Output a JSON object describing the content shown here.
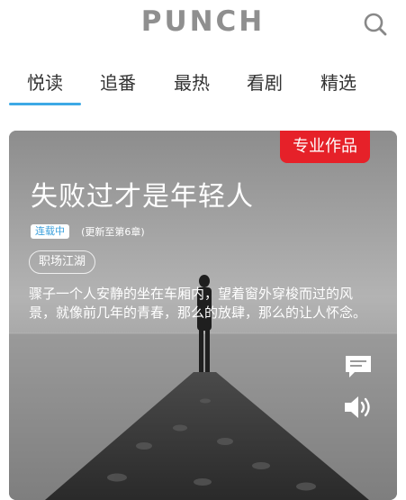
{
  "header": {
    "logo_text": "PUNCH",
    "search_icon": "search-icon"
  },
  "tabs": [
    {
      "label": "悦读",
      "active": true
    },
    {
      "label": "追番",
      "active": false
    },
    {
      "label": "最热",
      "active": false
    },
    {
      "label": "看剧",
      "active": false
    },
    {
      "label": "精选",
      "active": false
    }
  ],
  "colors": {
    "accent": "#3da9e6",
    "pro_tag": "#e62129",
    "logo": "#8f8f8f"
  },
  "card": {
    "pro_tag": "专业作品",
    "title": "失败过才是年轻人",
    "status_badge": "连载中",
    "update_text": "(更新至第6章)",
    "genre": "职场江湖",
    "description": "骤子一个人安静的坐在车厢内，望着窗外穿梭而过的风景，就像前几年的青春，那么的放肆，那么的让人怀念。",
    "icons": [
      "comment-icon",
      "speaker-icon"
    ]
  }
}
